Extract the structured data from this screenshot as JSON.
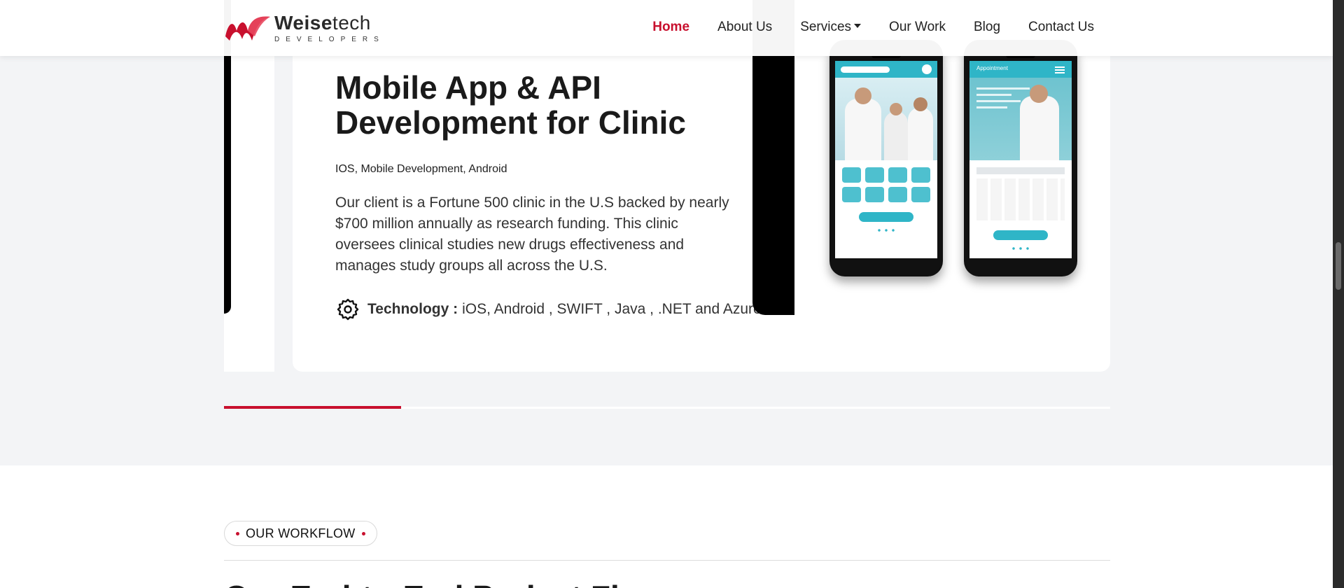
{
  "header": {
    "logo_name_bold": "Weise",
    "logo_name_light": "tech",
    "logo_tagline": "DEVELOPERS",
    "nav": [
      {
        "label": "Home",
        "active": true
      },
      {
        "label": "About Us"
      },
      {
        "label": "Services",
        "has_dropdown": true
      },
      {
        "label": "Our Work"
      },
      {
        "label": "Blog"
      },
      {
        "label": "Contact Us"
      }
    ]
  },
  "slide": {
    "title": "Mobile App & API Development for Clinic",
    "tags": "IOS, Mobile Development, Android",
    "description": "Our client is a Fortune 500 clinic in the U.S backed by nearly $700 million annually as research funding. This clinic oversees clinical studies new drugs effectiveness and manages study groups all across the U.S.",
    "technology_label": "Technology :",
    "technology_value": "iOS, Android , SWIFT , Java , .NET and Azure",
    "technology_icon": "gear-icon",
    "phone_screens": [
      {
        "name": "home-screen",
        "header_text": ""
      },
      {
        "name": "appointment-screen",
        "header_text": "Appointment"
      }
    ]
  },
  "slider": {
    "progress": 0.2
  },
  "workflow": {
    "pill_label": "OUR WORKFLOW",
    "heading": "Our End-to-End Project Flow"
  },
  "colors": {
    "brand": "#c8102e",
    "section_bg": "#f3f4f6",
    "app_accent": "#2fb5c7"
  }
}
